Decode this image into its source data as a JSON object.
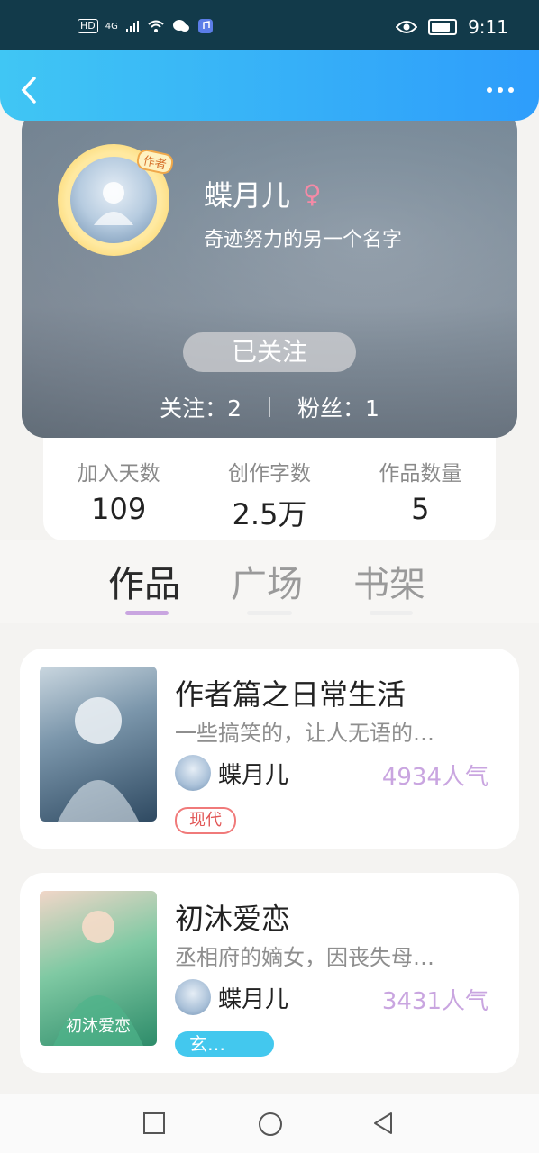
{
  "status_bar": {
    "hd": "HD",
    "network": "4G",
    "time": "9:11"
  },
  "profile": {
    "avatar_tag": "作者",
    "name": "蝶月儿",
    "gender_symbol": "♀",
    "bio": "奇迹努力的另一个名字",
    "follow_button": "已关注",
    "following_label": "关注：",
    "following_count": "2",
    "fans_label": "粉丝：",
    "fans_count": "1"
  },
  "stats": [
    {
      "label": "加入天数",
      "value": "109"
    },
    {
      "label": "创作字数",
      "value": "2.5万"
    },
    {
      "label": "作品数量",
      "value": "5"
    }
  ],
  "tabs": [
    {
      "label": "作品",
      "active": true
    },
    {
      "label": "广场",
      "active": false
    },
    {
      "label": "书架",
      "active": false
    }
  ],
  "works": [
    {
      "title": "作者篇之日常生活",
      "desc": "一些搞笑的，让人无语的…",
      "author": "蝶月儿",
      "popularity": "4934人气",
      "tag": "现代"
    },
    {
      "title": "初沐爱恋",
      "desc": "丞相府的嫡女，因丧失母…",
      "author": "蝶月儿",
      "popularity": "3431人气",
      "tag": "玄…",
      "cover_text": "初沐爱恋"
    }
  ],
  "colors": {
    "accent_blue": "#2e9dfb",
    "tab_indicator": "#c9a5e0",
    "popularity": "#c9a5e0"
  }
}
